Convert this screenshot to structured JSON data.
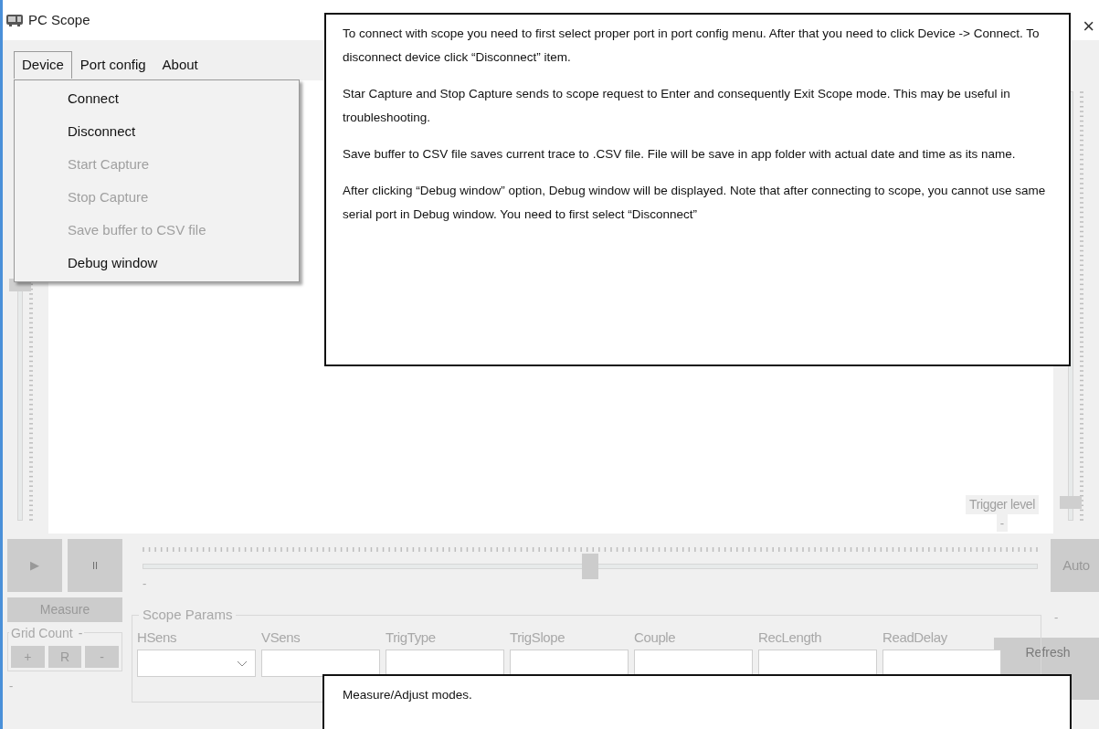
{
  "window": {
    "title": "PC Scope",
    "close": "×"
  },
  "menu": [
    {
      "label": "Device",
      "selected": true
    },
    {
      "label": "Port config",
      "selected": false
    },
    {
      "label": "About",
      "selected": false
    }
  ],
  "dropdown": [
    {
      "label": "Connect",
      "disabled": false
    },
    {
      "label": "Disconnect",
      "disabled": false
    },
    {
      "label": "Start Capture",
      "disabled": true
    },
    {
      "label": "Stop Capture",
      "disabled": true
    },
    {
      "label": "Save buffer to CSV file",
      "disabled": true
    },
    {
      "label": "Debug window",
      "disabled": false
    }
  ],
  "left_slider": {
    "level": 0.55
  },
  "right_slider": {
    "level": 0.04
  },
  "trigger": {
    "label": "Trigger level",
    "value": "-"
  },
  "controls": {
    "play": "▶",
    "pause": "II",
    "measure": "Measure",
    "grid_count": {
      "title": "Grid Count",
      "value": "-",
      "buttons": [
        "+",
        "R",
        "-"
      ]
    },
    "footer_value": "-"
  },
  "time_slider": {
    "level": 0.5,
    "value": "-"
  },
  "auto": "Auto",
  "auto_value": "-",
  "scope_params": {
    "title": "Scope Params",
    "fields": [
      {
        "label": "HSens",
        "kind": "dropdown"
      },
      {
        "label": "VSens",
        "kind": "text"
      },
      {
        "label": "TrigType",
        "kind": "text"
      },
      {
        "label": "TrigSlope",
        "kind": "text"
      },
      {
        "label": "Couple",
        "kind": "text"
      },
      {
        "label": "RecLength",
        "kind": "text"
      },
      {
        "label": "ReadDelay",
        "kind": "text"
      }
    ],
    "refresh": "Refresh"
  },
  "callouts": [
    {
      "paragraphs": [
        "To connect with scope you need to first select proper port in port config menu. After that you need to click Device -> Connect. To disconnect device click “Disconnect” item.",
        "Star Capture and Stop Capture sends to scope request to Enter and consequently Exit Scope mode. This may be useful in troubleshooting.",
        "Save buffer to CSV file saves current trace to .CSV file. File will be save in app folder with actual date and time as its name.",
        "After clicking “Debug window” option, Debug window will be displayed. Note that after connecting to scope, you cannot use same serial port in Debug window. You need to first select “Disconnect”"
      ]
    },
    {
      "paragraphs": [
        "Measure/Adjust modes."
      ]
    }
  ]
}
